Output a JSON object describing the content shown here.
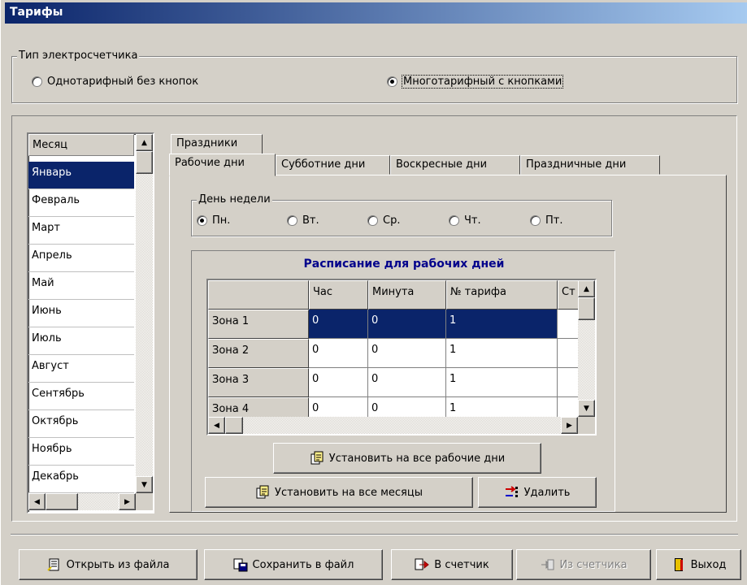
{
  "window": {
    "title": "Тарифы"
  },
  "meter_type": {
    "legend": "Тип электросчетчика",
    "options": [
      {
        "label": "Однотарифный без кнопок",
        "selected": false
      },
      {
        "label": "Многотарифный с кнопками",
        "selected": true
      }
    ]
  },
  "months": {
    "header": "Месяц",
    "items": [
      "Январь",
      "Февраль",
      "Март",
      "Апрель",
      "Май",
      "Июнь",
      "Июль",
      "Август",
      "Сентябрь",
      "Октябрь",
      "Ноябрь",
      "Декабрь"
    ],
    "selected": "Январь"
  },
  "tabs": {
    "row_top": [
      "Праздники"
    ],
    "row_bottom": [
      "Рабочие дни",
      "Субботние дни",
      "Воскресные дни",
      "Праздничные дни"
    ],
    "active": "Рабочие дни"
  },
  "weekday": {
    "legend": "День недели",
    "options": [
      {
        "label": "Пн.",
        "selected": true
      },
      {
        "label": "Вт.",
        "selected": false
      },
      {
        "label": "Ср.",
        "selected": false
      },
      {
        "label": "Чт.",
        "selected": false
      },
      {
        "label": "Пт.",
        "selected": false
      }
    ]
  },
  "schedule": {
    "title": "Расписание для рабочих дней",
    "columns": [
      "",
      "Час",
      "Минута",
      "№ тарифа",
      "Ст"
    ],
    "rows": [
      {
        "zone": "Зона 1",
        "hour": "0",
        "minute": "0",
        "tariff": "1"
      },
      {
        "zone": "Зона 2",
        "hour": "0",
        "minute": "0",
        "tariff": "1"
      },
      {
        "zone": "Зона 3",
        "hour": "0",
        "minute": "0",
        "tariff": "1"
      },
      {
        "zone": "Зона 4",
        "hour": "0",
        "minute": "0",
        "tariff": "1"
      }
    ]
  },
  "actions": {
    "set_all_workdays": "Установить на все рабочие дни",
    "set_all_months": "Установить на все месяцы",
    "delete": "Удалить"
  },
  "bottom_buttons": {
    "open": "Открыть из файла",
    "save": "Сохранить в файл",
    "to_meter": "В счетчик",
    "from_meter": "Из счетчика",
    "exit": "Выход"
  },
  "colors": {
    "selection": "#0a246a",
    "face": "#d4d0c8"
  }
}
